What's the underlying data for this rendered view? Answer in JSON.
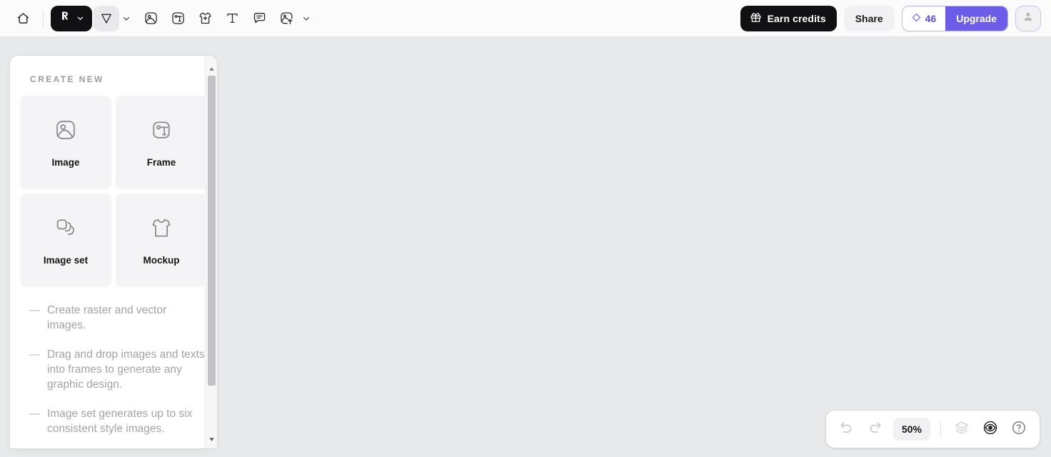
{
  "header": {
    "left_tools": [
      {
        "name": "home-icon",
        "label": "Home"
      },
      {
        "name": "brand-logo",
        "label": "Recraft"
      },
      {
        "name": "cursor-tool-icon",
        "label": "Select"
      },
      {
        "name": "image-tool-icon",
        "label": "Image"
      },
      {
        "name": "frame-tool-icon",
        "label": "Frame"
      },
      {
        "name": "mockup-tool-icon",
        "label": "Mockup"
      },
      {
        "name": "text-tool-icon",
        "label": "Text"
      },
      {
        "name": "comment-tool-icon",
        "label": "Comment"
      },
      {
        "name": "upload-tool-icon",
        "label": "Upload"
      }
    ],
    "earn_credits_label": "Earn credits",
    "share_label": "Share",
    "credits_value": "46",
    "upgrade_label": "Upgrade",
    "gift_icon": "gift-icon",
    "credit_diamond_icon": "diamond-icon",
    "avatar_icon": "user-avatar-icon"
  },
  "panel": {
    "title": "CREATE NEW",
    "cards": [
      {
        "label": "Image",
        "icon": "image-icon"
      },
      {
        "label": "Frame",
        "icon": "frame-text-icon"
      },
      {
        "label": "Image set",
        "icon": "stacked-squares-icon"
      },
      {
        "label": "Mockup",
        "icon": "tshirt-icon"
      }
    ],
    "bullet_marker": "—",
    "bullets": [
      "Create raster and vector images.",
      "Drag and drop images and texts into frames to generate any graphic design.",
      "Image set generates up to six consistent style images."
    ]
  },
  "bottom_bar": {
    "undo_label": "Undo",
    "redo_label": "Redo",
    "zoom_level": "50%",
    "layers_label": "Layers",
    "preview_label": "Preview",
    "help_label": "Help"
  },
  "colors": {
    "accent_purple": "#6c5ce7",
    "dark": "#111113",
    "canvas": "#e8e9eb",
    "panel": "#ffffff",
    "muted_text": "#a3a3a8"
  }
}
